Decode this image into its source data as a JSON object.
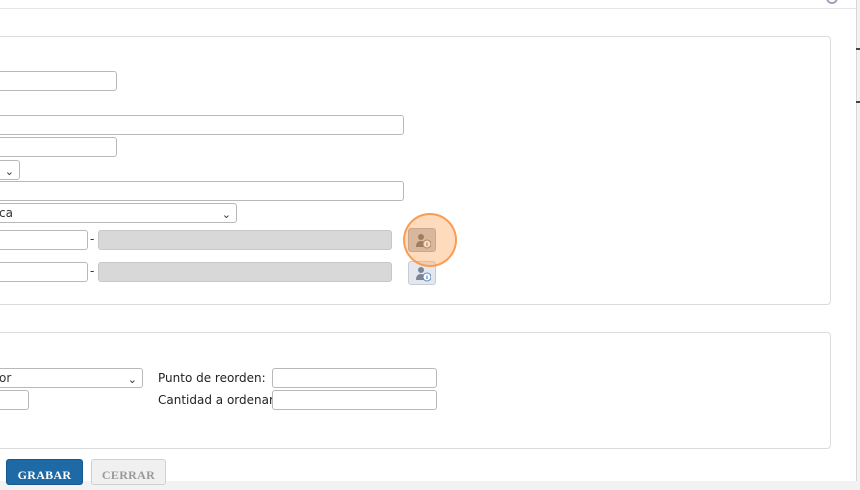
{
  "dialog": {
    "top_panel": {
      "category_select_value": "ca",
      "supplier_separator": "-",
      "alt_supplier_separator": "-"
    },
    "bottom_panel": {
      "type_select_value": "or",
      "reorder_point_label": "Punto de reorden:",
      "order_quantity_label": "Cantidad a ordenar:"
    },
    "buttons": {
      "save": "GRABAR",
      "close": "CERRAR"
    }
  },
  "icons": {
    "supplier_lookup": "person-info-icon",
    "alt_supplier_lookup": "person-info-icon",
    "select_arrow": "chevron-down-icon"
  },
  "colors": {
    "primary_button": "#1e6aa6",
    "disabled_field": "#d8d8d8",
    "click_highlight": "#ffaf6e"
  }
}
